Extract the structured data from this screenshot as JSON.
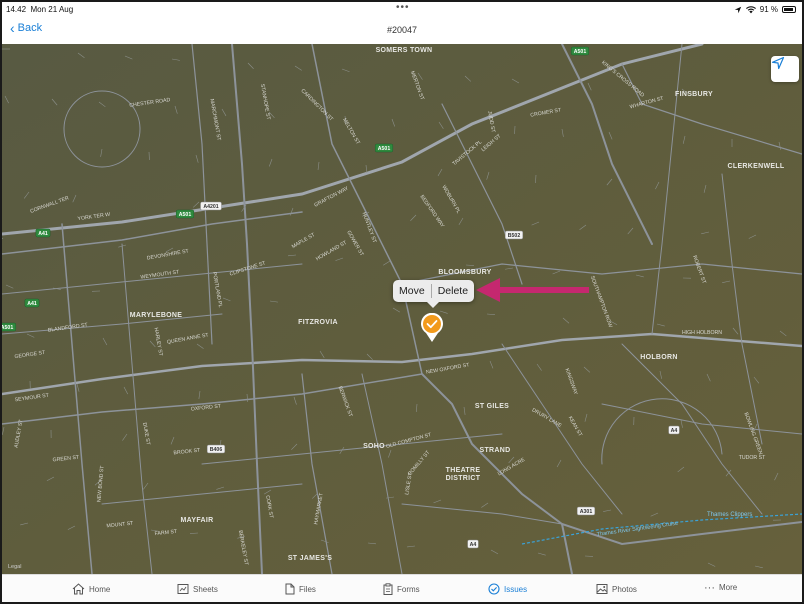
{
  "status_bar": {
    "time": "14.42",
    "date": "Mon 21 Aug",
    "battery": "91 %"
  },
  "nav": {
    "back_label": "Back",
    "title": "#20047"
  },
  "popover": {
    "move_label": "Move",
    "delete_label": "Delete"
  },
  "map": {
    "legal": "Legal",
    "areas": [
      {
        "name": "SOMERS TOWN"
      },
      {
        "name": "FINSBURY"
      },
      {
        "name": "CLERKENWELL"
      },
      {
        "name": "MARYLEBONE"
      },
      {
        "name": "FITZROVIA"
      },
      {
        "name": "BLOOMSBURY"
      },
      {
        "name": "HOLBORN"
      },
      {
        "name": "ST GILES"
      },
      {
        "name": "SOHO"
      },
      {
        "name": "STRAND"
      },
      {
        "name": "THEATRE"
      },
      {
        "name": "DISTRICT"
      },
      {
        "name": "MAYFAIR"
      },
      {
        "name": "ST JAMES'S"
      }
    ],
    "streets": [
      "CHESTER ROAD",
      "CORNWALL TER",
      "YORK TER W",
      "DEVONSHIRE ST",
      "WEYMOUTH ST",
      "BLANDFORD ST",
      "GEORGE ST",
      "SEYMOUR ST",
      "OXFORD ST",
      "GREEN ST",
      "MOUNT ST",
      "FARM ST",
      "QUEEN ANNE ST",
      "CLIPSTONE ST",
      "GRAFTON WAY",
      "HOWLAND ST",
      "MAPLE ST",
      "NEW OXFORD ST",
      "BROOK ST",
      "OLD COMPTON ST",
      "ROMILLY ST",
      "TAVISTOCK PL",
      "WOBURN PL",
      "BEDFORD WAY",
      "CROMER ST",
      "WHARTON ST",
      "KING'S CROSS ROAD",
      "BOWLING GREEN",
      "TUDOR ST",
      "CARDINGTON ST",
      "MELTON ST",
      "MERTON ST",
      "JUDD ST",
      "LEIGH ST",
      "GOWER ST",
      "SOUTHAMPTON ROW",
      "HUNTLEY ST",
      "PORTLAND PL",
      "HARLEY ST",
      "BERWICK ST",
      "ROBERT ST",
      "STANHOPE ST",
      "MARCHMONT ST",
      "HIGH HOLBORN",
      "DRURY LANE",
      "KEAN ST",
      "KINGSWAY",
      "LONG ACRE",
      "LISLE ST",
      "HAYMARKET",
      "BERKELEY ST",
      "CORK ST",
      "NEW BOND ST",
      "DUKE ST",
      "AUDLEY ST"
    ],
    "road_badges": [
      "A501",
      "A501",
      "A501",
      "A501",
      "A4201",
      "A41",
      "A41",
      "B502",
      "B406",
      "A4",
      "A301",
      "A4"
    ],
    "river_label": "Thames Clippers",
    "cruise_label": "Thames River Sightseeing Cruise",
    "colors": {
      "map_bg": "#5d5d3e",
      "road": "#9aa0a8",
      "highlight": "#c5286f",
      "pin": "#f29a1c"
    }
  },
  "tabs": [
    {
      "label": "Home",
      "icon": "home-icon"
    },
    {
      "label": "Sheets",
      "icon": "sheets-icon"
    },
    {
      "label": "Files",
      "icon": "file-icon"
    },
    {
      "label": "Forms",
      "icon": "clipboard-icon"
    },
    {
      "label": "Issues",
      "icon": "check-circle-icon",
      "active": true
    },
    {
      "label": "Photos",
      "icon": "photo-icon"
    },
    {
      "label": "More",
      "icon": "more-icon"
    }
  ]
}
